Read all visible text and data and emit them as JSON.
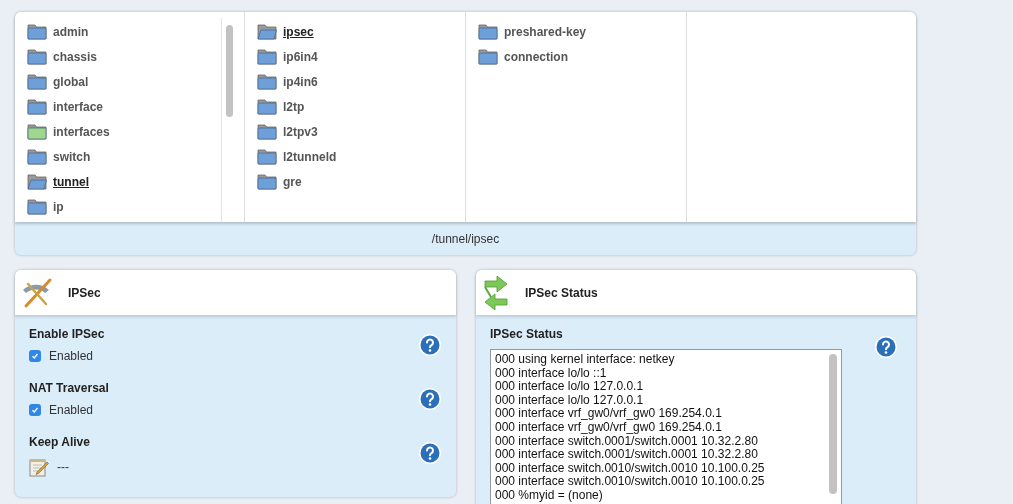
{
  "browser": {
    "columns": [
      {
        "items": [
          {
            "label": "admin",
            "selected": false,
            "color": "#6f9fd8"
          },
          {
            "label": "chassis",
            "selected": false,
            "color": "#6f9fd8"
          },
          {
            "label": "global",
            "selected": false,
            "color": "#6f9fd8"
          },
          {
            "label": "interface",
            "selected": false,
            "color": "#6f9fd8"
          },
          {
            "label": "interfaces",
            "selected": false,
            "color": "#9fd88a"
          },
          {
            "label": "switch",
            "selected": false,
            "color": "#6f9fd8"
          },
          {
            "label": "tunnel",
            "selected": true,
            "color": "#6f9fd8"
          },
          {
            "label": "ip",
            "selected": false,
            "color": "#6f9fd8"
          }
        ]
      },
      {
        "items": [
          {
            "label": "ipsec",
            "selected": true,
            "color": "#6f9fd8"
          },
          {
            "label": "ip6in4",
            "selected": false,
            "color": "#6f9fd8"
          },
          {
            "label": "ip4in6",
            "selected": false,
            "color": "#6f9fd8"
          },
          {
            "label": "l2tp",
            "selected": false,
            "color": "#6f9fd8"
          },
          {
            "label": "l2tpv3",
            "selected": false,
            "color": "#6f9fd8"
          },
          {
            "label": "l2tunneld",
            "selected": false,
            "color": "#6f9fd8"
          },
          {
            "label": "gre",
            "selected": false,
            "color": "#6f9fd8"
          }
        ]
      },
      {
        "items": [
          {
            "label": "preshared-key",
            "selected": false,
            "color": "#6f9fd8"
          },
          {
            "label": "connection",
            "selected": false,
            "color": "#6f9fd8"
          }
        ]
      },
      {}
    ],
    "path": "/tunnel/ipsec"
  },
  "ipsec_panel": {
    "title": "IPSec",
    "fields": [
      {
        "kind": "checkbox",
        "label": "Enable IPSec",
        "value": "Enabled",
        "checked": true
      },
      {
        "kind": "checkbox",
        "label": "NAT Traversal",
        "value": "Enabled",
        "checked": true
      },
      {
        "kind": "text",
        "label": "Keep Alive",
        "value": "---"
      }
    ]
  },
  "status_panel": {
    "title": "IPSec Status",
    "label": "IPSec Status",
    "lines": [
      "000 using kernel interface: netkey",
      "000 interface lo/lo ::1",
      "000 interface lo/lo 127.0.0.1",
      "000 interface lo/lo 127.0.0.1",
      "000 interface vrf_gw0/vrf_gw0 169.254.0.1",
      "000 interface vrf_gw0/vrf_gw0 169.254.0.1",
      "000 interface switch.0001/switch.0001 10.32.2.80",
      "000 interface switch.0001/switch.0001 10.32.2.80",
      "000 interface switch.0010/switch.0010 10.100.0.25",
      "000 interface switch.0010/switch.0010 10.100.0.25",
      "000 %myid = (none)"
    ]
  }
}
